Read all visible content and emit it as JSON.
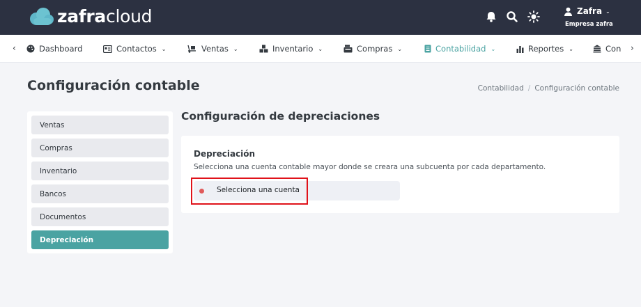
{
  "app": {
    "brand_bold": "zafra",
    "brand_light": "cloud"
  },
  "header": {
    "user_name": "Zafra",
    "company": "Empresa zafra",
    "icons": [
      "bell-icon",
      "search-icon",
      "sun-icon",
      "user-icon"
    ]
  },
  "nav": {
    "items": [
      {
        "label": "Dashboard",
        "icon": "palette-icon",
        "has_dropdown": false
      },
      {
        "label": "Contactos",
        "icon": "contacts-card-icon",
        "has_dropdown": true
      },
      {
        "label": "Ventas",
        "icon": "dolly-icon",
        "has_dropdown": true
      },
      {
        "label": "Inventario",
        "icon": "boxes-icon",
        "has_dropdown": true
      },
      {
        "label": "Compras",
        "icon": "cash-register-icon",
        "has_dropdown": true
      },
      {
        "label": "Contabilidad",
        "icon": "ledger-icon",
        "has_dropdown": true,
        "active": true
      },
      {
        "label": "Reportes",
        "icon": "bar-chart-icon",
        "has_dropdown": true
      },
      {
        "label": "Con",
        "icon": "bank-icon",
        "has_dropdown": false
      }
    ]
  },
  "page": {
    "title": "Configuración contable",
    "breadcrumb": [
      "Contabilidad",
      "Configuración contable"
    ]
  },
  "sidebar": {
    "items": [
      {
        "label": "Ventas"
      },
      {
        "label": "Compras"
      },
      {
        "label": "Inventario"
      },
      {
        "label": "Bancos"
      },
      {
        "label": "Documentos"
      },
      {
        "label": "Depreciación",
        "active": true
      }
    ]
  },
  "main": {
    "section_title": "Configuración de depreciaciones",
    "card": {
      "title": "Depreciación",
      "description": "Selecciona una cuenta contable mayor donde se creara una subcuenta por cada departamento.",
      "select_placeholder": "Selecciona una cuenta"
    }
  },
  "colors": {
    "topbar": "#2c3141",
    "accent": "#4aa3a2",
    "highlight": "#e0121a",
    "status_dot": "#e05a5a"
  }
}
